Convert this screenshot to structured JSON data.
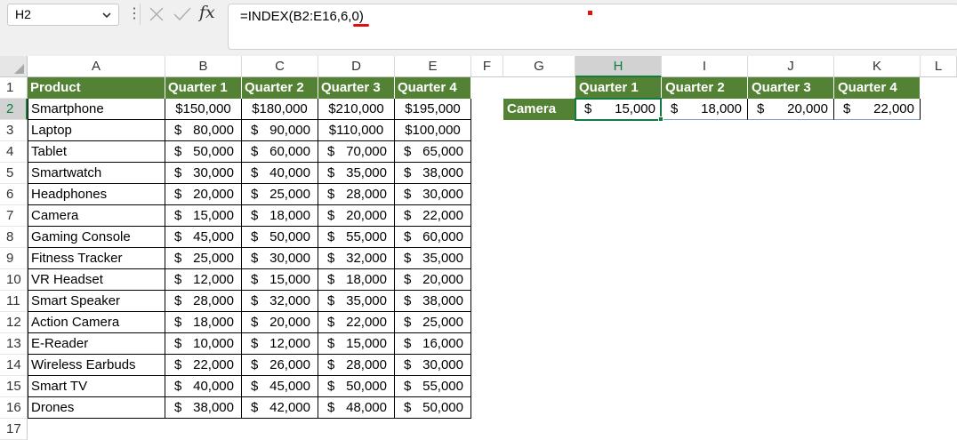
{
  "formula_bar": {
    "name_box": "H2",
    "formula": "=INDEX(B2:E16,6,0)",
    "fx_label": "fx",
    "more_label": "⋮"
  },
  "columns": [
    "A",
    "B",
    "C",
    "D",
    "E",
    "F",
    "G",
    "H",
    "I",
    "J",
    "K",
    "L"
  ],
  "selected_column": "H",
  "rows": [
    "1",
    "2",
    "3",
    "4",
    "5",
    "6",
    "7",
    "8",
    "9",
    "10",
    "11",
    "12",
    "13",
    "14",
    "15",
    "16",
    "17"
  ],
  "selected_row": "2",
  "table": {
    "headers": [
      "Product",
      "Quarter 1",
      "Quarter 2",
      "Quarter 3",
      "Quarter 4"
    ],
    "data": [
      [
        "Smartphone",
        "$150,000",
        "$180,000",
        "$210,000",
        "$195,000"
      ],
      [
        "Laptop",
        "$ 80,000",
        "$ 90,000",
        "$110,000",
        "$100,000"
      ],
      [
        "Tablet",
        "$ 50,000",
        "$ 60,000",
        "$ 70,000",
        "$ 65,000"
      ],
      [
        "Smartwatch",
        "$ 30,000",
        "$ 40,000",
        "$ 35,000",
        "$ 38,000"
      ],
      [
        "Headphones",
        "$ 20,000",
        "$ 25,000",
        "$ 28,000",
        "$ 30,000"
      ],
      [
        "Camera",
        "$ 15,000",
        "$ 18,000",
        "$ 20,000",
        "$ 22,000"
      ],
      [
        "Gaming Console",
        "$ 45,000",
        "$ 50,000",
        "$ 55,000",
        "$ 60,000"
      ],
      [
        "Fitness Tracker",
        "$ 25,000",
        "$ 30,000",
        "$ 32,000",
        "$ 35,000"
      ],
      [
        "VR Headset",
        "$ 12,000",
        "$ 15,000",
        "$ 18,000",
        "$ 20,000"
      ],
      [
        "Smart Speaker",
        "$ 28,000",
        "$ 32,000",
        "$ 35,000",
        "$ 38,000"
      ],
      [
        "Action Camera",
        "$ 18,000",
        "$ 20,000",
        "$ 22,000",
        "$ 25,000"
      ],
      [
        "E-Reader",
        "$ 10,000",
        "$ 12,000",
        "$ 15,000",
        "$ 16,000"
      ],
      [
        "Wireless Earbuds",
        "$ 22,000",
        "$ 26,000",
        "$ 28,000",
        "$ 30,000"
      ],
      [
        "Smart TV",
        "$ 40,000",
        "$ 45,000",
        "$ 50,000",
        "$ 55,000"
      ],
      [
        "Drones",
        "$ 38,000",
        "$ 42,000",
        "$ 48,000",
        "$ 50,000"
      ]
    ]
  },
  "result": {
    "label": "Camera",
    "headers": [
      "Quarter 1",
      "Quarter 2",
      "Quarter 3",
      "Quarter 4"
    ],
    "values": [
      "$ 15,000",
      "$ 18,000",
      "$ 20,000",
      "$ 22,000"
    ]
  },
  "colors": {
    "header_green": "#548235",
    "selection_green": "#107c41",
    "annotation_red": "#e01010"
  }
}
